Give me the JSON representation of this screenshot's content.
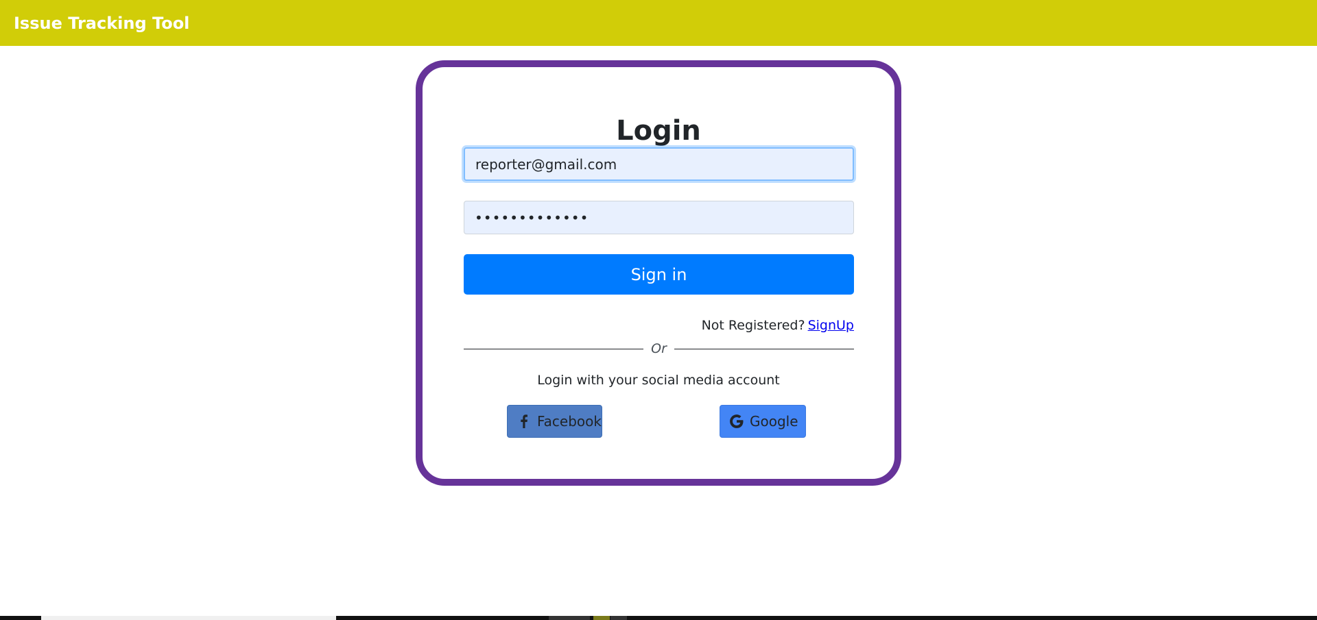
{
  "navbar": {
    "brand": "Issue Tracking Tool",
    "color": "#d1cd08"
  },
  "login": {
    "title": "Login",
    "email_value": "reporter@gmail.com",
    "password_value": "•••••••••••••",
    "signin_label": "Sign in",
    "not_registered_text": "Not Registered?",
    "signup_link": "SignUp",
    "divider_text": "Or",
    "social_text": "Login with your social media account",
    "facebook_label": "Facebook",
    "google_label": "Google",
    "border_color": "#663399",
    "signin_color": "#007bff"
  },
  "icons": {
    "facebook": "facebook-icon",
    "google": "google-icon"
  }
}
